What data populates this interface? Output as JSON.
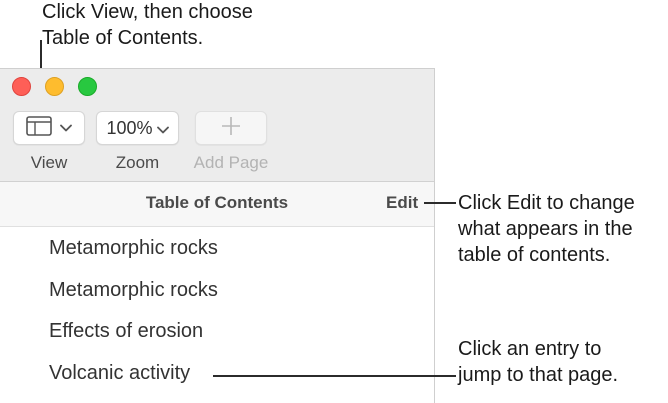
{
  "callouts": {
    "view": [
      "Click View, then choose",
      "Table of Contents."
    ],
    "edit": [
      "Click Edit to change",
      "what appears in the",
      "table of contents."
    ],
    "entry": [
      "Click an entry to",
      "jump to that page."
    ]
  },
  "toolbar": {
    "view_label": "View",
    "zoom_value": "100%",
    "zoom_label": "Zoom",
    "add_page_label": "Add Page",
    "icons": [
      "sidebar-icon",
      "chevron-down-icon",
      "plus-icon"
    ]
  },
  "toc": {
    "title": "Table of Contents",
    "edit_label": "Edit",
    "entries": [
      "Metamorphic rocks",
      "Metamorphic rocks",
      "Effects of erosion",
      "Volcanic activity"
    ]
  },
  "colors": {
    "close": "#fe5f57",
    "minimize": "#febc2e",
    "zoom": "#28c840"
  }
}
